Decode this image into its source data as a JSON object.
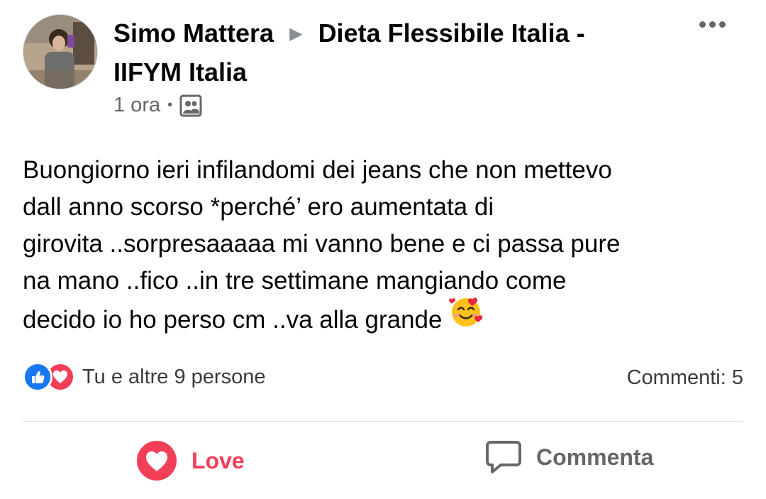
{
  "post": {
    "author": "Simo Mattera",
    "group_prefix": "Dieta Flessibile Italia -",
    "group_suffix": "IIFYM Italia",
    "time": "1 ora",
    "text_lines": [
      "Buongiorno ieri infilandomi dei jeans che non mettevo",
      "dall anno scorso *perché’ ero aumentata di",
      "girovita ..sorpresaaaaa mi vanno bene e ci passa pure",
      "na mano ..fico ..in tre settimane mangiando come",
      "decido io ho perso cm ..va alla grande"
    ]
  },
  "reactions": {
    "summary": "Tu e altre 9 persone",
    "comments": "Commenti: 5"
  },
  "actions": {
    "love_label": "Love",
    "comment_label": "Commenta"
  },
  "icons": {
    "audience": "group-icon",
    "more": "more-icon",
    "emoji": "smiling-face-with-hearts"
  },
  "colors": {
    "love": "#f33e58",
    "like": "#1877f2",
    "secondary_text": "#65676b"
  }
}
